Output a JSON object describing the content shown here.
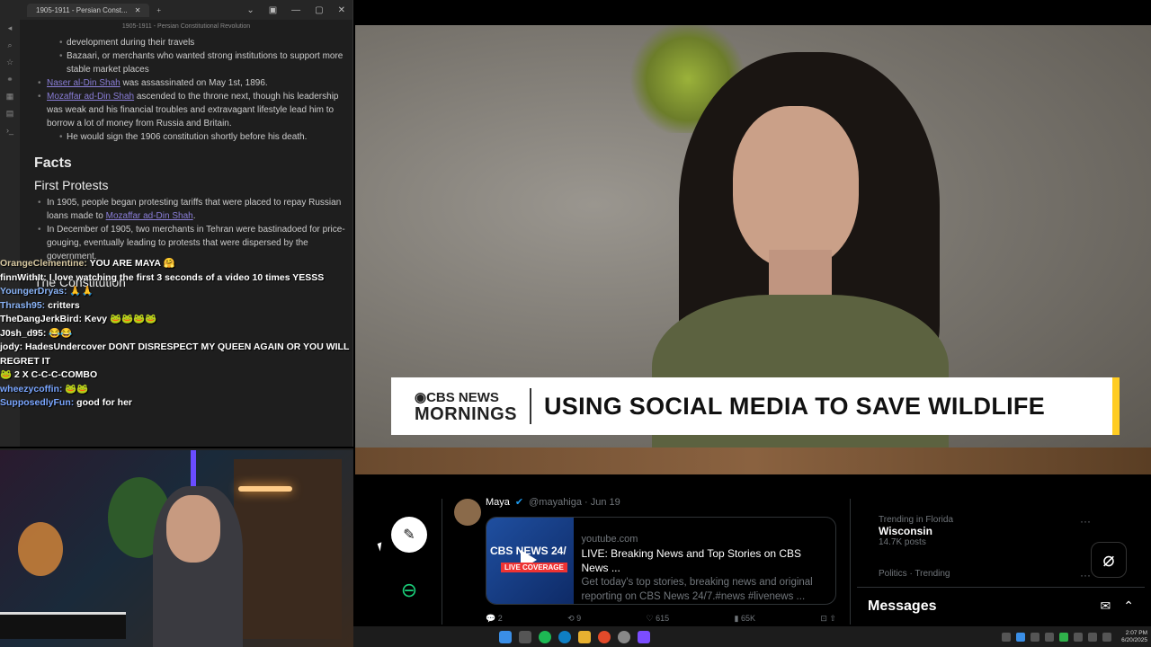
{
  "notes": {
    "tab_title": "1905-1911 - Persian Const...",
    "header_title": "1905-1911 - Persian Constitutional Revolution",
    "lines_top": [
      {
        "level": 2,
        "text": "development during their travels"
      },
      {
        "level": 2,
        "text": "Bazaari, or merchants who wanted strong institutions to support more stable market places"
      }
    ],
    "naser_link": "Naser al-Din Shah",
    "naser_rest": " was assassinated on May 1st, 1896.",
    "mozaffar_link": "Mozaffar ad-Din Shah",
    "mozaffar_rest": " ascended to the throne next, though his leadership was weak and his financial troubles and extravagant lifestyle lead him to borrow a lot of money from Russia and Britain.",
    "sign_line": "He would sign the 1906 constitution shortly before his death.",
    "h_facts": "Facts",
    "h_first_protests": "First Protests",
    "p1_text": "In 1905, people began protesting tariffs that were placed to repay Russian loans made to ",
    "p1_link": "Mozaffar ad-Din Shah",
    "p1_end": ".",
    "p2_text": "In December of 1905, two merchants in Tehran were bastinadoed for price-gouging, eventually leading to protests that were dispersed by the government.",
    "h_constitution": "The Constitution"
  },
  "chat": [
    {
      "user": "OrangeClementine:",
      "msg": " YOU ARE MAYA 🤗"
    },
    {
      "user": "finnWithIt:",
      "msg": " I love watching the first 3 seconds of a video 10 times YESSS"
    },
    {
      "user": "YoungerDryas:",
      "msg": " 🙏🙏"
    },
    {
      "user": "Thrash95:",
      "msg": " critters"
    },
    {
      "user": "TheDangJerkBird:",
      "msg": " Kevy 🐸🐸🐸🐸"
    },
    {
      "user": "J0sh_d95:",
      "msg": " 😂😂"
    },
    {
      "user": "jody:",
      "msg": " HadesUndercover DONT DISRESPECT MY QUEEN AGAIN OR YOU WILL REGRET IT"
    },
    {
      "user": "🐸 2 X",
      "msg": " C-C-C-COMBO"
    },
    {
      "user": "wheezycoffin:",
      "msg": " 🐸🐸"
    },
    {
      "user": "SupposedlyFun:",
      "msg": " good for her"
    }
  ],
  "video": {
    "logo_line1": "CBS NEWS",
    "logo_line2": "MORNINGS",
    "headline": "USING SOCIAL MEDIA TO SAVE WILDLIFE"
  },
  "twitter": {
    "author": "Maya",
    "handle": "@mayahiga · Jun 19",
    "card_thumb": "CBS NEWS 24/",
    "card_live": "LIVE COVERAGE",
    "card_domain": "youtube.com",
    "card_title": "LIVE: Breaking News and Top Stories on CBS News ...",
    "card_desc": "Get today's top stories, breaking news and original reporting on CBS News 24/7.#news #livenews ...",
    "actions": [
      "2",
      "9",
      "615",
      "65K"
    ],
    "trend1_meta": "Trending in Florida",
    "trend1_name": "Wisconsin",
    "trend1_posts": "14.7K posts",
    "trend2_meta": "Politics · Trending",
    "messages_label": "Messages"
  },
  "taskbar": {
    "time": "2:07 PM",
    "date": "6/20/2025"
  }
}
